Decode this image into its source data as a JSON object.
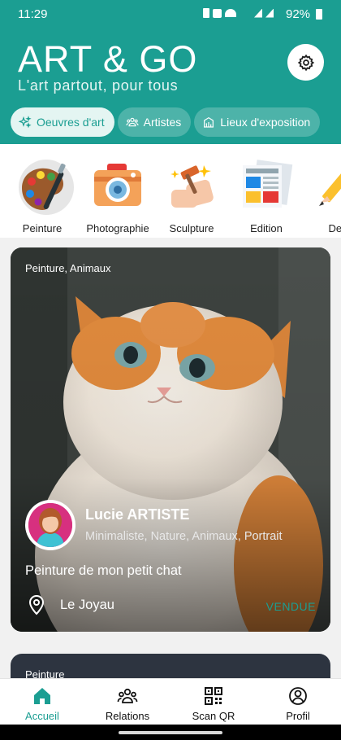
{
  "status": {
    "time": "11:29",
    "battery": "92%"
  },
  "header": {
    "title": "ART & GO",
    "subtitle": "L'art partout, pour tous",
    "tabs": [
      {
        "label": "Oeuvres d'art",
        "icon": "sparkles-icon",
        "active": true
      },
      {
        "label": "Artistes",
        "icon": "people-icon",
        "active": false
      },
      {
        "label": "Lieux d'exposition",
        "icon": "museum-icon",
        "active": false
      }
    ]
  },
  "categories": [
    {
      "label": "Peinture",
      "icon": "palette-icon"
    },
    {
      "label": "Photographie",
      "icon": "camera-icon"
    },
    {
      "label": "Sculpture",
      "icon": "sculpture-icon"
    },
    {
      "label": "Edition",
      "icon": "newspaper-icon"
    },
    {
      "label": "Des",
      "icon": "pencil-icon"
    }
  ],
  "card": {
    "tags": "Peinture, Animaux",
    "artist_name": "Lucie ARTISTE",
    "artist_tags": "Minimaliste, Nature, Animaux, Portrait",
    "title": "Peinture de mon petit chat",
    "location": "Le Joyau",
    "status": "VENDUE"
  },
  "card2": {
    "tags": "Peinture"
  },
  "nav": [
    {
      "label": "Accueil",
      "icon": "home-icon",
      "active": true
    },
    {
      "label": "Relations",
      "icon": "relations-icon",
      "active": false
    },
    {
      "label": "Scan QR",
      "icon": "qr-code-icon",
      "active": false
    },
    {
      "label": "Profil",
      "icon": "profile-icon",
      "active": false
    }
  ],
  "colors": {
    "primary": "#1b9e92",
    "tab_inactive": "#4db3a9",
    "tab_active_bg": "#e4f5f2"
  }
}
